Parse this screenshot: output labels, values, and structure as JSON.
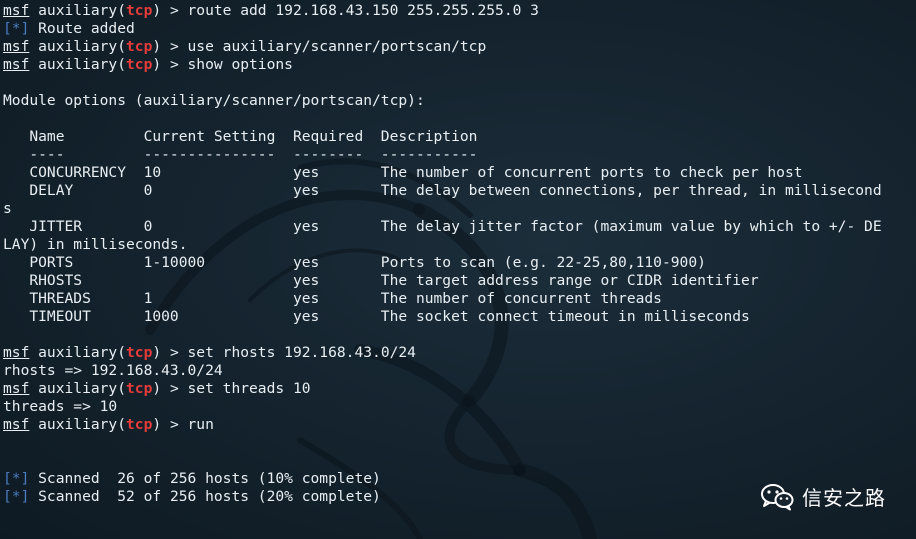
{
  "terminal": {
    "lines": [
      [
        {
          "t": "msf",
          "c": "u"
        },
        {
          "t": " auxiliary("
        },
        {
          "t": "tcp",
          "c": "red"
        },
        {
          "t": ") > route add 192.168.43.150 255.255.255.0 3"
        }
      ],
      [
        {
          "t": "[*]",
          "c": "blue"
        },
        {
          "t": " Route added"
        }
      ],
      [
        {
          "t": "msf",
          "c": "u"
        },
        {
          "t": " auxiliary("
        },
        {
          "t": "tcp",
          "c": "red"
        },
        {
          "t": ") > use auxiliary/scanner/portscan/tcp"
        }
      ],
      [
        {
          "t": "msf",
          "c": "u"
        },
        {
          "t": " auxiliary("
        },
        {
          "t": "tcp",
          "c": "red"
        },
        {
          "t": ") > show options"
        }
      ],
      [],
      [
        {
          "t": "Module options (auxiliary/scanner/portscan/tcp):"
        }
      ],
      [],
      [
        {
          "t": "   Name         Current Setting  Required  Description"
        }
      ],
      [
        {
          "t": "   ----         ---------------  --------  -----------"
        }
      ],
      [
        {
          "t": "   CONCURRENCY  10               yes       The number of concurrent ports to check per host"
        }
      ],
      [
        {
          "t": "   DELAY        0                yes       The delay between connections, per thread, in millisecond"
        }
      ],
      [
        {
          "t": "s"
        }
      ],
      [
        {
          "t": "   JITTER       0                yes       The delay jitter factor (maximum value by which to +/- DE"
        }
      ],
      [
        {
          "t": "LAY) in milliseconds."
        }
      ],
      [
        {
          "t": "   PORTS        1-10000          yes       Ports to scan (e.g. 22-25,80,110-900)"
        }
      ],
      [
        {
          "t": "   RHOSTS                        yes       The target address range or CIDR identifier"
        }
      ],
      [
        {
          "t": "   THREADS      1                yes       The number of concurrent threads"
        }
      ],
      [
        {
          "t": "   TIMEOUT      1000             yes       The socket connect timeout in milliseconds"
        }
      ],
      [],
      [
        {
          "t": "msf",
          "c": "u"
        },
        {
          "t": " auxiliary("
        },
        {
          "t": "tcp",
          "c": "red"
        },
        {
          "t": ") > set rhosts 192.168.43.0/24"
        }
      ],
      [
        {
          "t": "rhosts => 192.168.43.0/24"
        }
      ],
      [
        {
          "t": "msf",
          "c": "u"
        },
        {
          "t": " auxiliary("
        },
        {
          "t": "tcp",
          "c": "red"
        },
        {
          "t": ") > set threads 10"
        }
      ],
      [
        {
          "t": "threads => 10"
        }
      ],
      [
        {
          "t": "msf",
          "c": "u"
        },
        {
          "t": " auxiliary("
        },
        {
          "t": "tcp",
          "c": "red"
        },
        {
          "t": ") > run"
        }
      ],
      [],
      [],
      [
        {
          "t": "[*]",
          "c": "blue"
        },
        {
          "t": " Scanned  26 of 256 hosts (10% complete)"
        }
      ],
      [
        {
          "t": "[*]",
          "c": "blue"
        },
        {
          "t": " Scanned  52 of 256 hosts (20% complete)"
        }
      ]
    ]
  },
  "watermark": {
    "text": "信安之路",
    "icon": "wechat-icon"
  },
  "colors": {
    "background": "#15242f",
    "text": "#e8eef2",
    "prompt_module": "#e63b3b",
    "status_marker": "#4a7cc0"
  }
}
